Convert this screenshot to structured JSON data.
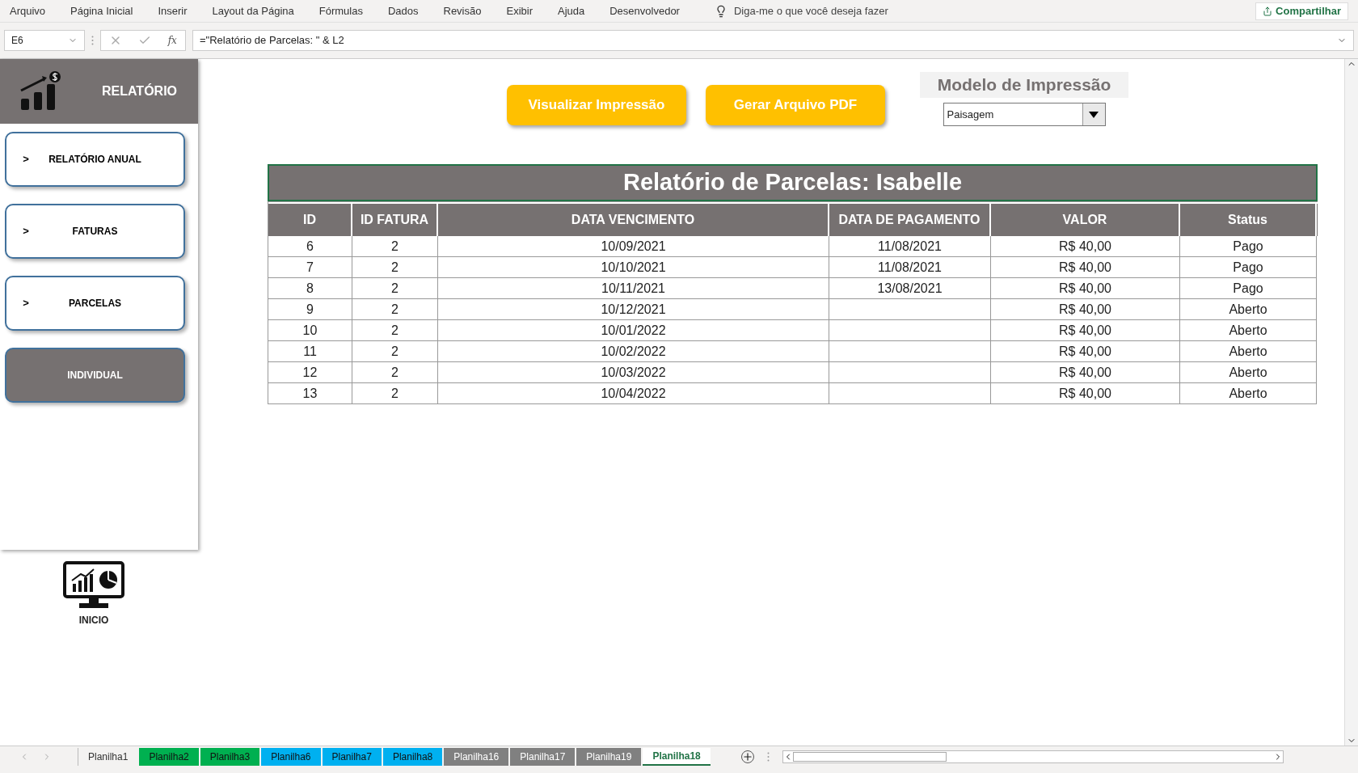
{
  "menu": [
    "Arquivo",
    "Página Inicial",
    "Inserir",
    "Layout da Página",
    "Fórmulas",
    "Dados",
    "Revisão",
    "Exibir",
    "Ajuda",
    "Desenvolvedor"
  ],
  "tell_me": {
    "placeholder": "Diga-me o que você deseja fazer"
  },
  "share_button": "Compartilhar",
  "formula_bar": {
    "cell": "E6",
    "function_symbol": "fx",
    "formula": "=\"Relatório de Parcelas: \" & L2"
  },
  "sidebar": {
    "title": "RELATÓRIO",
    "items": [
      {
        "marker": ">",
        "label": "RELATÓRIO ANUAL",
        "selected": false
      },
      {
        "marker": ">",
        "label": "FATURAS",
        "selected": false
      },
      {
        "marker": ">",
        "label": "PARCELAS",
        "selected": false
      },
      {
        "label": "INDIVIDUAL",
        "selected": true
      }
    ],
    "home_label": "INICIO"
  },
  "actions": [
    "Visualizar Impressão",
    "Gerar Arquivo PDF"
  ],
  "print_model": {
    "label": "Modelo de Impressão",
    "value": "Paisagem"
  },
  "report": {
    "title": "Relatório de Parcelas: Isabelle",
    "columns": [
      "ID",
      "ID FATURA",
      "DATA VENCIMENTO",
      "DATA DE PAGAMENTO",
      "VALOR",
      "Status"
    ],
    "rows": [
      [
        "6",
        "2",
        "10/09/2021",
        "11/08/2021",
        "R$ 40,00",
        "Pago"
      ],
      [
        "7",
        "2",
        "10/10/2021",
        "11/08/2021",
        "R$ 40,00",
        "Pago"
      ],
      [
        "8",
        "2",
        "10/11/2021",
        "13/08/2021",
        "R$ 40,00",
        "Pago"
      ],
      [
        "9",
        "2",
        "10/12/2021",
        "",
        "R$ 40,00",
        "Aberto"
      ],
      [
        "10",
        "2",
        "10/01/2022",
        "",
        "R$ 40,00",
        "Aberto"
      ],
      [
        "11",
        "2",
        "10/02/2022",
        "",
        "R$ 40,00",
        "Aberto"
      ],
      [
        "12",
        "2",
        "10/03/2022",
        "",
        "R$ 40,00",
        "Aberto"
      ],
      [
        "13",
        "2",
        "10/04/2022",
        "",
        "R$ 40,00",
        "Aberto"
      ]
    ]
  },
  "sheet_tabs": [
    {
      "label": "Planilha1",
      "selected": false
    },
    {
      "label": "Planilha2",
      "selected": false,
      "color": "#00b050"
    },
    {
      "label": "Planilha3",
      "selected": false,
      "color": "#00b050"
    },
    {
      "label": "Planilha6",
      "selected": false,
      "color": "#00b0f0"
    },
    {
      "label": "Planilha7",
      "selected": false,
      "color": "#00b0f0"
    },
    {
      "label": "Planilha8",
      "selected": false,
      "color": "#00b0f0"
    },
    {
      "label": "Planilha16",
      "selected": false,
      "color": "#808080"
    },
    {
      "label": "Planilha17",
      "selected": false,
      "color": "#808080"
    },
    {
      "label": "Planilha19",
      "selected": false,
      "color": "#808080"
    },
    {
      "label": "Planilha18",
      "selected": true
    }
  ]
}
